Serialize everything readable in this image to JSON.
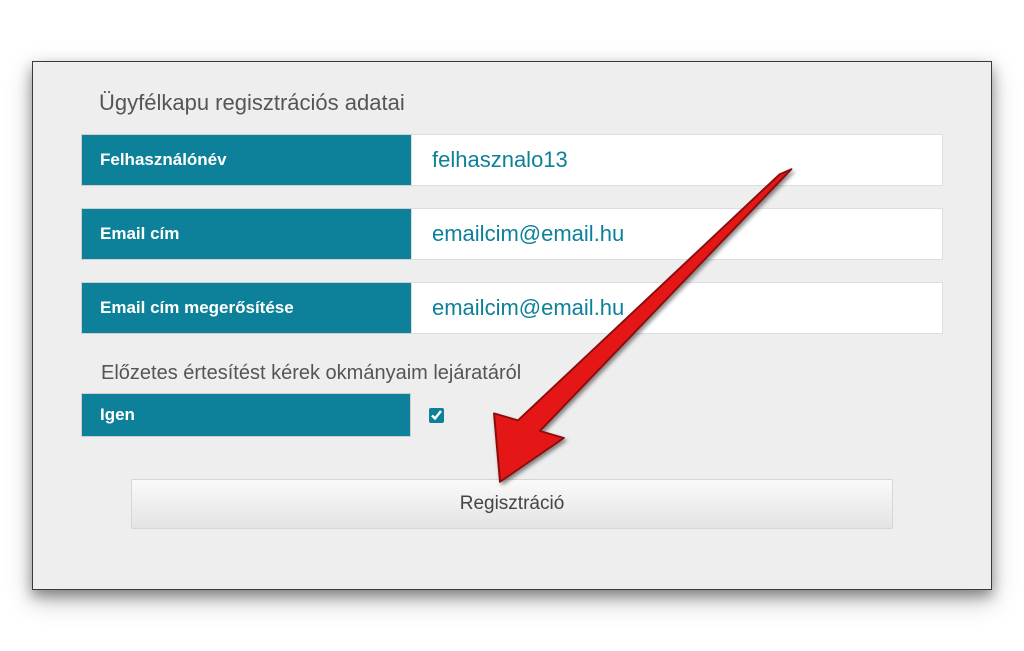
{
  "section_title": "Ügyfélkapu regisztrációs adatai",
  "fields": {
    "username": {
      "label": "Felhasználónév",
      "value": "felhasznalo13"
    },
    "email": {
      "label": "Email cím",
      "value": "emailcim@email.hu"
    },
    "email2": {
      "label": "Email cím megerősítése",
      "value": "emailcim@email.hu"
    }
  },
  "notice": {
    "title": "Előzetes értesítést kérek okmányaim lejáratáról",
    "yes_label": "Igen"
  },
  "submit_label": "Regisztráció"
}
